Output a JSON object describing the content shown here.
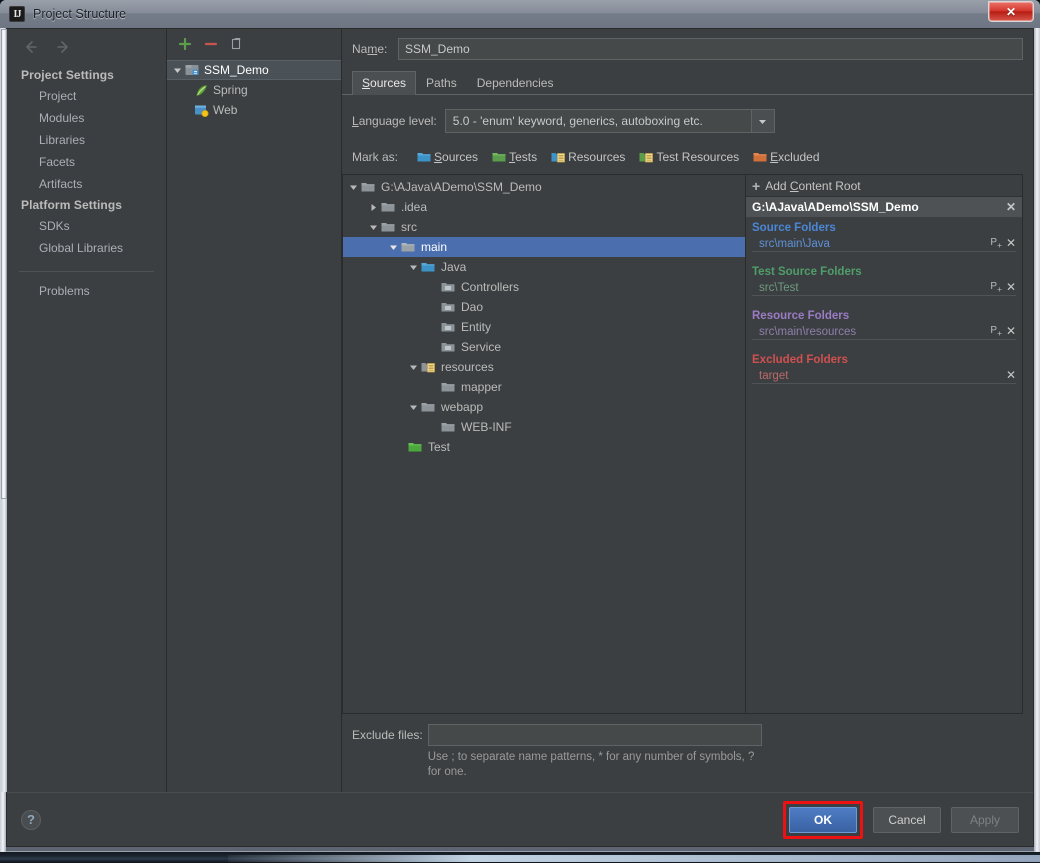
{
  "window": {
    "title": "Project Structure",
    "app_icon": "IJ",
    "close_label": "✕"
  },
  "sidebar": {
    "nav_back": "nav-back-arrow",
    "nav_forward": "nav-forward-arrow",
    "groups": [
      {
        "title": "Project Settings",
        "items": [
          "Project",
          "Modules",
          "Libraries",
          "Facets",
          "Artifacts"
        ]
      },
      {
        "title": "Platform Settings",
        "items": [
          "SDKs",
          "Global Libraries"
        ]
      }
    ],
    "problems": "Problems"
  },
  "modules": {
    "toolbar": [
      {
        "name": "add-module-button",
        "glyph": "+",
        "color": "#5a9e4b"
      },
      {
        "name": "remove-module-button",
        "glyph": "−",
        "color": "#c75450"
      },
      {
        "name": "copy-module-button",
        "glyph": "⎘",
        "color": "#9aa0a6"
      }
    ],
    "tree": [
      {
        "label": "SSM_Demo",
        "level": 0,
        "expanded": true,
        "selected": true,
        "icon": "module-icon"
      },
      {
        "label": "Spring",
        "level": 1,
        "expanded": null,
        "selected": false,
        "icon": "spring-leaf-icon"
      },
      {
        "label": "Web",
        "level": 1,
        "expanded": null,
        "selected": false,
        "icon": "web-facet-icon"
      }
    ]
  },
  "main": {
    "name_label": "Name:",
    "name_value": "SSM_Demo",
    "tabs": [
      {
        "label": "Sources",
        "active": true
      },
      {
        "label": "Paths",
        "active": false
      },
      {
        "label": "Dependencies",
        "active": false
      }
    ],
    "language_level_label": "Language level:",
    "language_level_value": "5.0 - 'enum' keyword, generics, autoboxing etc.",
    "mark_as_label": "Mark as:",
    "mark_as": [
      {
        "label": "Sources",
        "color": "#3d93c7"
      },
      {
        "label": "Tests",
        "color": "#5a9e4b"
      },
      {
        "label": "Resources",
        "color": "#3d93c7",
        "badge": true
      },
      {
        "label": "Test Resources",
        "color": "#5a9e4b",
        "badge": true
      },
      {
        "label": "Excluded",
        "color": "#d2703a"
      }
    ],
    "exclude_files_label": "Exclude files:",
    "exclude_files_value": "",
    "exclude_hint": "Use ; to separate name patterns, * for any number of symbols, ? for one."
  },
  "file_tree": [
    {
      "label": "G:\\AJava\\ADemo\\SSM_Demo",
      "level": 0,
      "tri": "down",
      "icon": "folder-plain",
      "selected": false
    },
    {
      "label": ".idea",
      "level": 1,
      "tri": "right",
      "icon": "folder-plain",
      "selected": false
    },
    {
      "label": "src",
      "level": 1,
      "tri": "down",
      "icon": "folder-plain",
      "selected": false
    },
    {
      "label": "main",
      "level": 2,
      "tri": "down",
      "icon": "folder-plain",
      "selected": true
    },
    {
      "label": "Java",
      "level": 3,
      "tri": "down",
      "icon": "folder-source",
      "selected": false
    },
    {
      "label": "Controllers",
      "level": 4,
      "tri": "none",
      "icon": "folder-package",
      "selected": false
    },
    {
      "label": "Dao",
      "level": 4,
      "tri": "none",
      "icon": "folder-package",
      "selected": false
    },
    {
      "label": "Entity",
      "level": 4,
      "tri": "none",
      "icon": "folder-package",
      "selected": false
    },
    {
      "label": "Service",
      "level": 4,
      "tri": "none",
      "icon": "folder-package",
      "selected": false
    },
    {
      "label": "resources",
      "level": 3,
      "tri": "down",
      "icon": "folder-resource",
      "selected": false
    },
    {
      "label": "mapper",
      "level": 4,
      "tri": "none",
      "icon": "folder-plain",
      "selected": false
    },
    {
      "label": "webapp",
      "level": 3,
      "tri": "down",
      "icon": "folder-plain",
      "selected": false
    },
    {
      "label": "WEB-INF",
      "level": 4,
      "tri": "none",
      "icon": "folder-plain",
      "selected": false
    },
    {
      "label": "Test",
      "level": 2,
      "tri": "none",
      "icon": "folder-test",
      "selected": false
    }
  ],
  "content_root": {
    "add_label": "Add Content Root",
    "add_label_pre": "Add ",
    "add_label_u": "C",
    "add_label_post": "ontent Root",
    "root_path": "G:\\AJava\\ADemo\\SSM_Demo",
    "close_glyph": "✕",
    "sections": [
      {
        "title": "Source Folders",
        "color": "#4a87d6",
        "path_color": "#5e91d8",
        "path": "src\\main\\Java",
        "has_props": true
      },
      {
        "title": "Test Source Folders",
        "color": "#4f9e6a",
        "path_color": "#6f9b81",
        "path": "src\\Test",
        "has_props": true
      },
      {
        "title": "Resource Folders",
        "color": "#9b7bc4",
        "path_color": "#8f7fad",
        "path": "src\\main\\resources",
        "has_props": true
      },
      {
        "title": "Excluded Folders",
        "color": "#d05050",
        "path_color": "#b96a6a",
        "path": "target",
        "has_props": false
      }
    ]
  },
  "footer": {
    "help_glyph": "?",
    "ok": "OK",
    "cancel": "Cancel",
    "apply": "Apply"
  },
  "colors": {
    "dialog_bg": "#3c3f41",
    "selection_blue": "#4b6eaf",
    "accent_red": "#ee1111",
    "primary_button": "#3a62a3"
  }
}
